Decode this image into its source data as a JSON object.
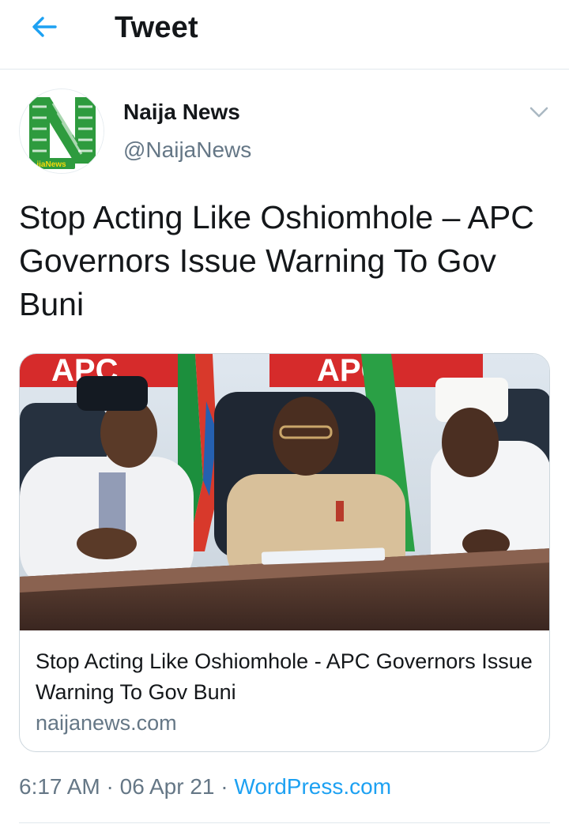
{
  "header": {
    "title": "Tweet",
    "back_icon": "arrow-left-icon"
  },
  "author": {
    "display_name": "Naija News",
    "handle": "@NaijaNews",
    "avatar_logo_text": "NaijaNews"
  },
  "tweet": {
    "text": "Stop Acting Like Oshiomhole – APC Governors Issue Warning To Gov Buni"
  },
  "card": {
    "image_banner_text": "APC",
    "title": "Stop Acting Like Oshiomhole - APC Governors Issue Warning To Gov Buni",
    "domain": "naijanews.com"
  },
  "meta": {
    "time": "6:17 AM",
    "date": "06 Apr 21",
    "separator": "·",
    "source": "WordPress.com"
  },
  "colors": {
    "accent": "#1da1f2",
    "text": "#14171a",
    "muted": "#657786",
    "border": "#e1e8ed",
    "logo_green": "#2e9b3e",
    "apc_red": "#d62b2b"
  }
}
